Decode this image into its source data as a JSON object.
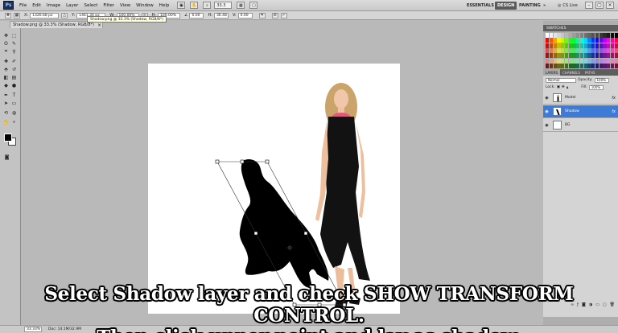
{
  "app": {
    "logo": "Ps"
  },
  "menu": [
    "File",
    "Edit",
    "Image",
    "Layer",
    "Select",
    "Filter",
    "View",
    "Window",
    "Help"
  ],
  "menubar": {
    "zoom": "33.3",
    "workspaces": [
      "ESSENTIALS",
      "DESIGN",
      "PAINTING"
    ],
    "active_workspace": "DESIGN",
    "cslive": "CS Live",
    "more": "»"
  },
  "options": {
    "x_label": "X:",
    "x_value": "1326.68 px",
    "y_label": "Y:",
    "y_value": "1461.34 px",
    "w_label": "W:",
    "w_value": "100.00%",
    "h_label": "H:",
    "h_value": "100.00%",
    "angle_label": "∠",
    "angle_value": "0.00",
    "h_skew_label": "H:",
    "h_skew_value": "36.48",
    "v_skew_label": "V:",
    "v_skew_value": "0.00",
    "cancel": "⊘",
    "commit": "✓"
  },
  "document": {
    "tab_title": "Shadow.png @ 33.3% (Shadow, RGB/8*)",
    "tooltip": "Shadow.png @ 33.3% (Shadow, RGB/8*)",
    "close": "×"
  },
  "layers_panel": {
    "tabs": [
      "LAYERS",
      "CHANNELS",
      "PATHS"
    ],
    "blend_mode": "Normal",
    "opacity_label": "Opacity:",
    "opacity_value": "100%",
    "lock_label": "Lock:",
    "fill_label": "Fill:",
    "fill_value": "100%",
    "layers": [
      {
        "name": "Model",
        "selected": false,
        "fx": "fx"
      },
      {
        "name": "Shadow",
        "selected": true,
        "fx": "fx"
      },
      {
        "name": "BG",
        "selected": false,
        "fx": ""
      }
    ],
    "footer_icons": [
      "link-icon",
      "fx-icon",
      "mask-icon",
      "adjustment-icon",
      "folder-icon",
      "new-layer-icon",
      "trash-icon"
    ]
  },
  "swatches": {
    "title": "SWATCHES"
  },
  "status": {
    "zoom": "33.33%",
    "doc": "Doc: 14.1M/32.9M"
  },
  "caption": {
    "line1": "Select Shadow layer and check SHOW TRANSFORM CONTROL.",
    "line2": "Then click upper point and lay as shadow."
  }
}
